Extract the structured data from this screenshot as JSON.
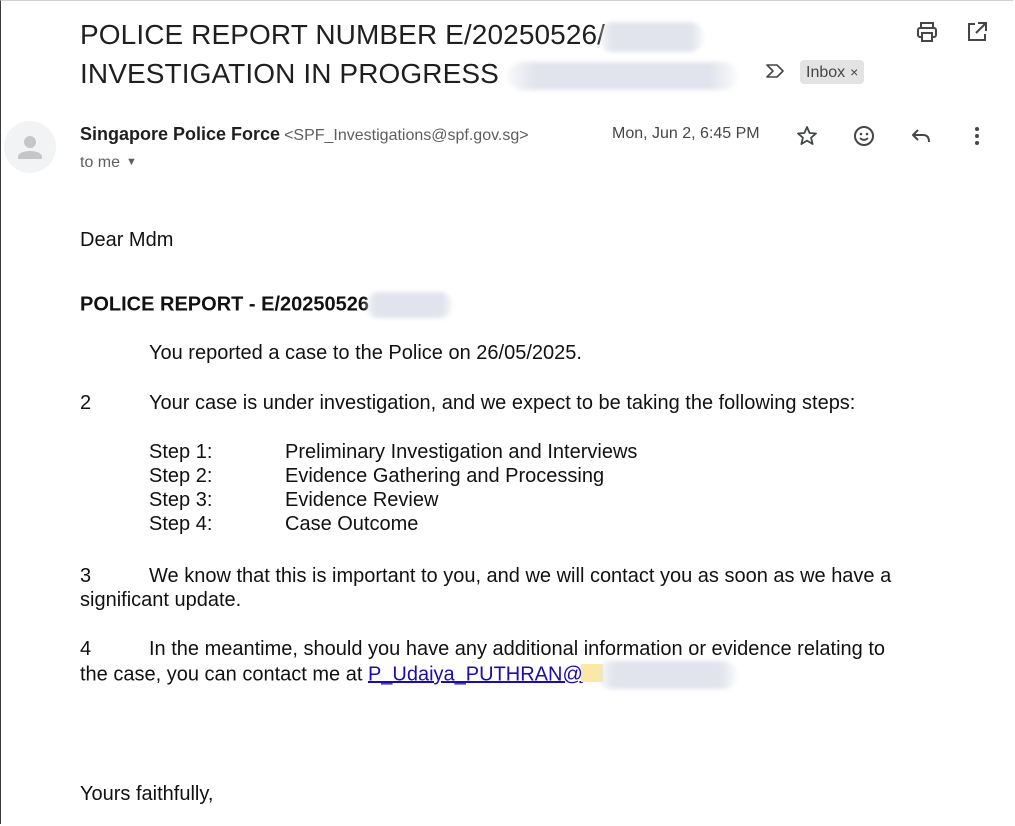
{
  "subject": {
    "line1": "POLICE REPORT NUMBER E/20250526/",
    "line2": "INVESTIGATION IN PROGRESS"
  },
  "labels": {
    "inbox": "Inbox",
    "inbox_close": "×"
  },
  "sender": {
    "name": "Singapore Police Force",
    "email": "<SPF_Investigations@spf.gov.sg>",
    "to": "to me",
    "date": "Mon, Jun 2, 6:45 PM"
  },
  "body": {
    "greeting": "Dear Mdm",
    "report_heading": "POLICE REPORT - E/20250526",
    "para1": "You reported a case to the Police on 26/05/2025.",
    "para2_num": "2",
    "para2": "Your case is under investigation, and we expect to be taking the following steps:",
    "steps": [
      {
        "label": "Step 1:",
        "text": "Preliminary Investigation and Interviews"
      },
      {
        "label": "Step 2:",
        "text": "Evidence Gathering and Processing"
      },
      {
        "label": "Step 3:",
        "text": "Evidence Review"
      },
      {
        "label": "Step 4:",
        "text": "Case Outcome"
      }
    ],
    "para3_num": "3",
    "para3_line1": "We know that this is important to you, and we will contact you as soon as we have a",
    "para3_line2": "significant update.",
    "para4_num": "4",
    "para4_line1": "In the meantime, should you have any additional information or evidence relating to",
    "para4_line2": "the case, you can contact me at",
    "contact_link": "P_Udaiya_PUTHRAN@",
    "signoff": "Yours faithfully,"
  },
  "icons": {
    "print": "print-icon",
    "popout": "open-in-new-window-icon",
    "importance": "importance-marker-icon",
    "star": "star-icon",
    "emoji": "add-reaction-icon",
    "reply": "reply-icon",
    "more": "more-vertical-icon",
    "avatar": "person-avatar-icon"
  }
}
